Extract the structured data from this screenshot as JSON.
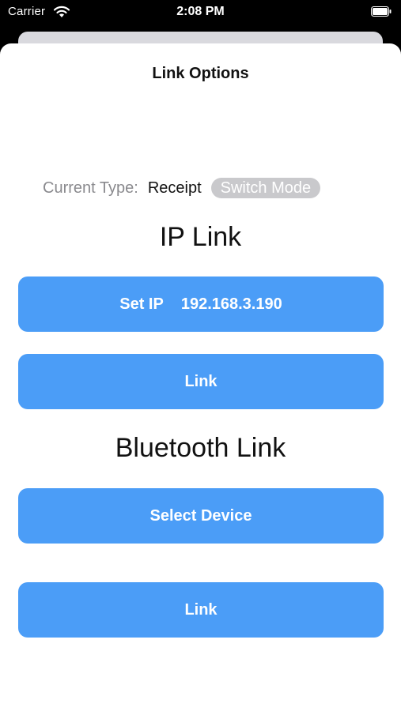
{
  "status_bar": {
    "carrier": "Carrier",
    "time": "2:08 PM",
    "icons": [
      "wifi-icon",
      "battery-icon"
    ]
  },
  "sheet": {
    "title": "Link Options",
    "current_type_label": "Current Type:",
    "current_type_value": "Receipt",
    "switch_mode_label": "Switch Mode",
    "ip_section_title": "IP Link",
    "set_ip_label": "Set IP",
    "ip_value": "192.168.3.190",
    "ip_link_label": "Link",
    "bluetooth_section_title": "Bluetooth Link",
    "select_device_label": "Select Device",
    "bluetooth_link_label": "Link"
  },
  "colors": {
    "button_blue": "#4b9df7",
    "switch_mode_gray": "#c9c9cc",
    "label_gray": "#8a8a8e"
  }
}
